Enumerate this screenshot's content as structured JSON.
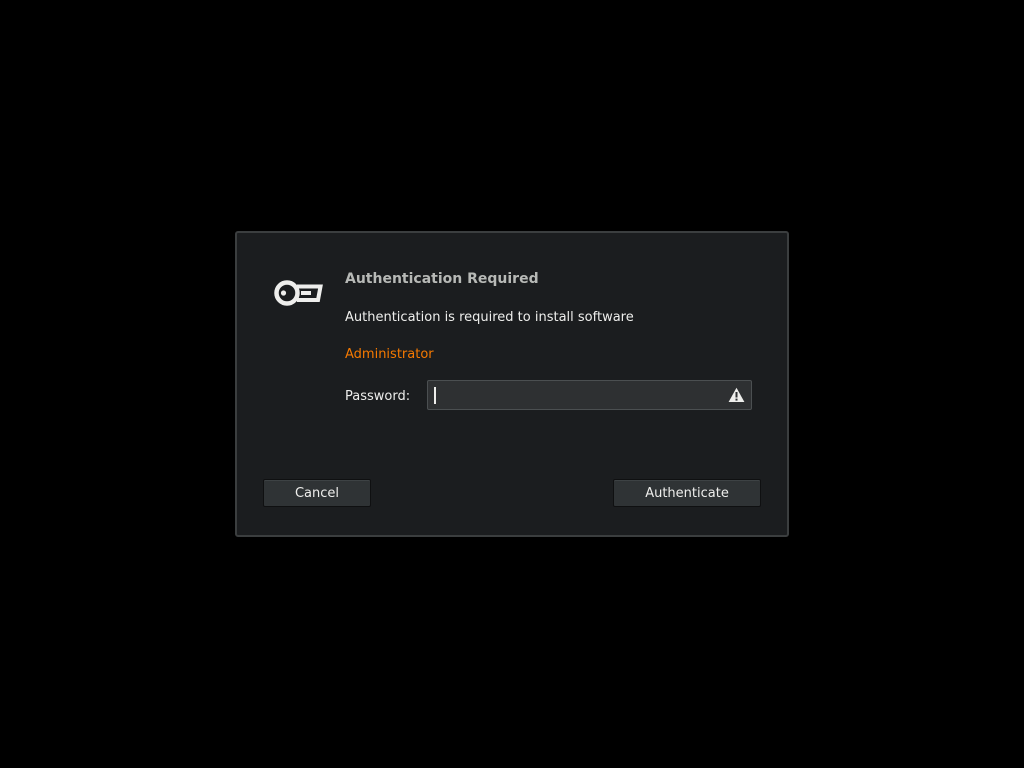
{
  "dialog": {
    "title": "Authentication Required",
    "message": "Authentication is required to install software",
    "user": "Administrator",
    "password_label": "Password:",
    "password_value": "",
    "cancel_label": "Cancel",
    "authenticate_label": "Authenticate",
    "icon": "key-icon",
    "warning_icon": "warning-icon"
  },
  "colors": {
    "background": "#000000",
    "dialog_bg": "#1b1d1f",
    "accent_user": "#f57900",
    "text": "#eeeeec",
    "title": "#b7b9b6"
  }
}
